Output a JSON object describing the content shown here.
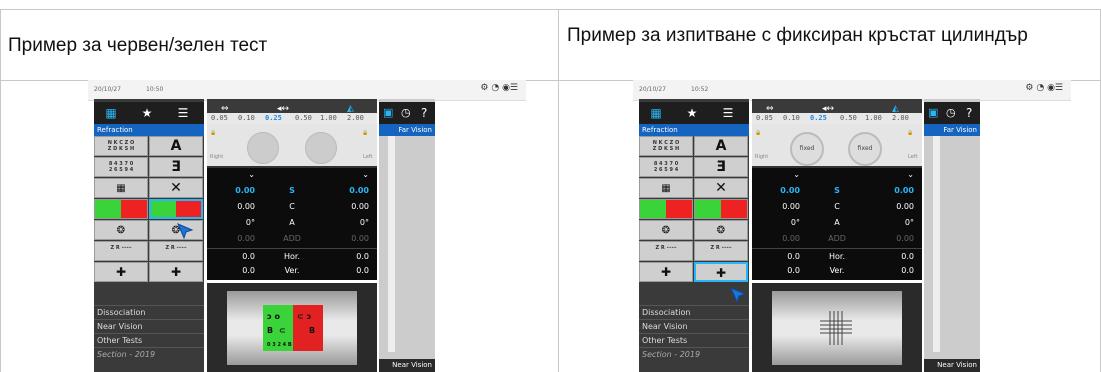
{
  "headers": {
    "left": "Пример за червен/зелен тест",
    "right": "Пример за изпитване с фиксиран кръстат цилиндър"
  },
  "device_left": {
    "date": "20/10/27",
    "time": "10:50",
    "left_menu": {
      "section": "Refraction",
      "items": [
        "Dissociation",
        "Near Vision",
        "Other Tests",
        "Section - 2019"
      ]
    },
    "scale": [
      "0.05",
      "0.10",
      "0.25",
      "0.50",
      "1.00",
      "2.00"
    ],
    "scale_selected": "0.25",
    "eye_labels": {
      "right": "Right",
      "left": "Left"
    },
    "values": {
      "s": {
        "label": "S",
        "r": "0.00",
        "l": "0.00"
      },
      "c": {
        "label": "C",
        "r": "0.00",
        "l": "0.00"
      },
      "a": {
        "label": "A",
        "r": "0°",
        "l": "0°"
      },
      "add": {
        "label": "ADD",
        "r": "0.00",
        "l": "0.00"
      },
      "hor": {
        "label": "Hor.",
        "r": "0.0",
        "l": "0.0"
      },
      "ver": {
        "label": "Ver.",
        "r": "0.0",
        "l": "0.0"
      }
    },
    "right_panel": {
      "top": "Far Vision",
      "bottom": "Near Vision"
    }
  },
  "device_right": {
    "date": "20/10/27",
    "time": "10:52",
    "left_menu": {
      "section": "Refraction",
      "items": [
        "Dissociation",
        "Near Vision",
        "Other Tests",
        "Section - 2019"
      ]
    },
    "scale": [
      "0.05",
      "0.10",
      "0.25",
      "0.50",
      "1.00",
      "2.00"
    ],
    "scale_selected": "0.25",
    "eye_labels": {
      "right": "Right",
      "left": "Left",
      "fixed": "fixed"
    },
    "values": {
      "s": {
        "label": "S",
        "r": "0.00",
        "l": "0.00"
      },
      "c": {
        "label": "C",
        "r": "0.00",
        "l": "0.00"
      },
      "a": {
        "label": "A",
        "r": "0°",
        "l": "0°"
      },
      "add": {
        "label": "ADD",
        "r": "0.00",
        "l": "0.00"
      },
      "hor": {
        "label": "Hor.",
        "r": "0.0",
        "l": "0.0"
      },
      "ver": {
        "label": "Ver.",
        "r": "0.0",
        "l": "0.0"
      }
    },
    "right_panel": {
      "top": "Far Vision",
      "bottom": "Near Vision"
    }
  },
  "icons": {
    "grid": "grid-icon",
    "star": "star-icon",
    "list": "list-icon",
    "help": "help-icon",
    "gear": "gear-icon",
    "cursor": "hand-pointer-icon"
  },
  "colors": {
    "accent": "#1565c0",
    "highlight": "#29b6f6",
    "green": "#3ad33a",
    "red": "#e22222"
  }
}
